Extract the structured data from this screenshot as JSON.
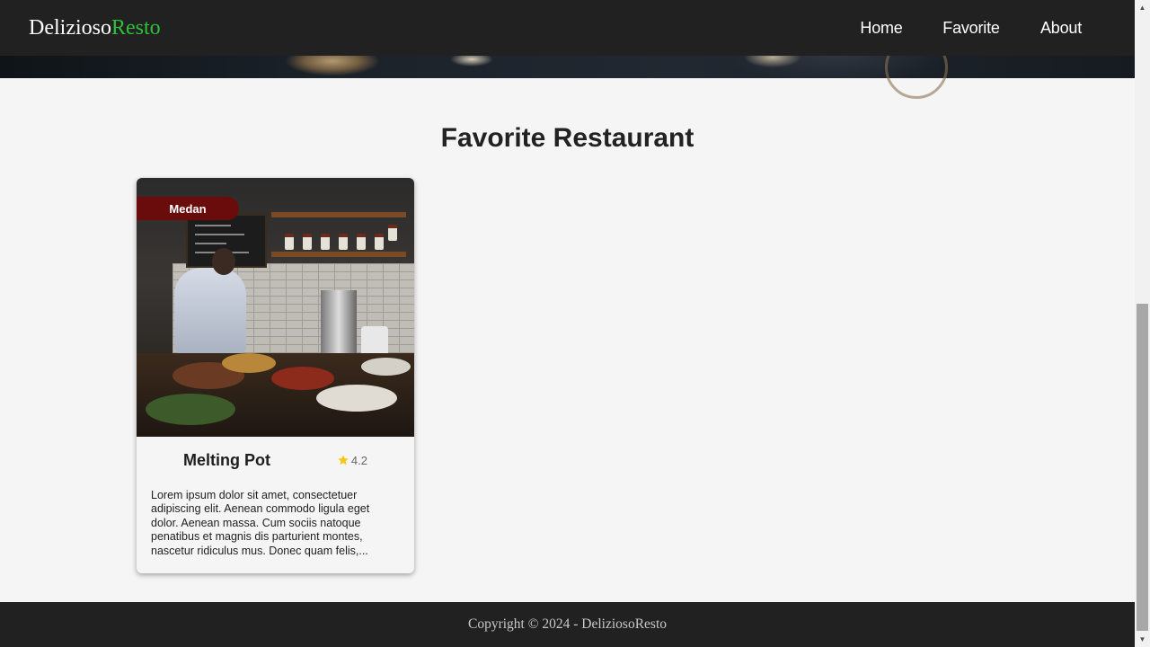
{
  "brand": {
    "name_main": "Delizioso",
    "name_accent": "Resto",
    "accent_color": "#2fbf3a"
  },
  "nav": {
    "items": [
      {
        "label": "Home"
      },
      {
        "label": "Favorite"
      },
      {
        "label": "About"
      }
    ]
  },
  "main": {
    "title": "Favorite Restaurant"
  },
  "restaurants": [
    {
      "city": "Medan",
      "name": "Melting Pot",
      "rating": "4.2",
      "description": "Lorem ipsum dolor sit amet, consectetuer adipiscing elit. Aenean commodo ligula eget dolor. Aenean massa. Cum sociis natoque penatibus et magnis dis parturient montes, nascetur ridiculus mus. Donec quam felis,..."
    }
  ],
  "footer": {
    "text": "Copyright © 2024 - DeliziosoResto"
  },
  "icons": {
    "rating": "star-icon",
    "scroll_up": "scroll-up-arrow-icon",
    "scroll_down": "scroll-down-arrow-icon"
  },
  "colors": {
    "navbar": "#212121",
    "badge": "#6b0c0c",
    "star": "#f5c518",
    "background": "#f5f5f5"
  }
}
